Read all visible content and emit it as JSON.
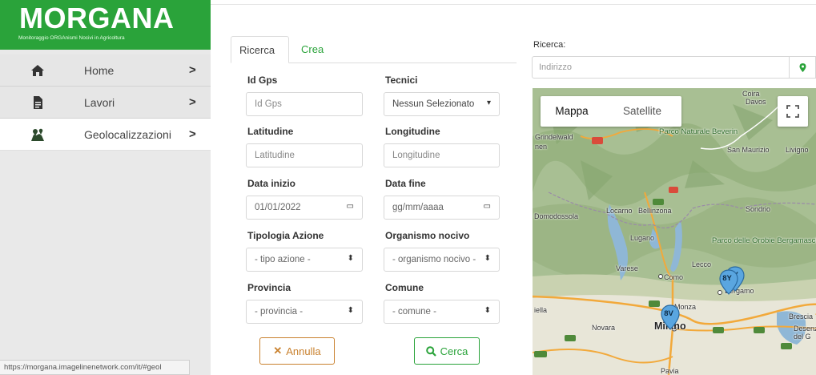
{
  "app": {
    "title": "MORGANA",
    "subtitle": "Monitoraggio ORGAnismi Nocivi in Agricoltura"
  },
  "sidebar": {
    "items": [
      {
        "label": "Home",
        "icon": "home-icon"
      },
      {
        "label": "Lavori",
        "icon": "document-icon"
      },
      {
        "label": "Geolocalizzazioni",
        "icon": "map-pins-icon",
        "active": true
      }
    ]
  },
  "status_url": "https://morgana.imagelinenetwork.com/it/#geol",
  "tabs": [
    {
      "label": "Ricerca",
      "active": true
    },
    {
      "label": "Crea",
      "active": false
    }
  ],
  "form": {
    "id_gps": {
      "label": "Id Gps",
      "placeholder": "Id Gps"
    },
    "tecnici": {
      "label": "Tecnici",
      "value": "Nessun Selezionato"
    },
    "latitudine": {
      "label": "Latitudine",
      "placeholder": "Latitudine"
    },
    "longitudine": {
      "label": "Longitudine",
      "placeholder": "Longitudine"
    },
    "data_inizio": {
      "label": "Data inizio",
      "value": "01/01/2022"
    },
    "data_fine": {
      "label": "Data fine",
      "value": "gg/mm/aaaa"
    },
    "tipologia_azione": {
      "label": "Tipologia Azione",
      "value": "- tipo azione -"
    },
    "organismo_nocivo": {
      "label": "Organismo nocivo",
      "value": "- organismo nocivo -"
    },
    "provincia": {
      "label": "Provincia",
      "value": "- provincia -"
    },
    "comune": {
      "label": "Comune",
      "value": "- comune -"
    }
  },
  "buttons": {
    "cancel": "Annulla",
    "search": "Cerca"
  },
  "map_search": {
    "label": "Ricerca:",
    "placeholder": "Indirizzo"
  },
  "map": {
    "type_map": "Mappa",
    "type_satellite": "Satellite",
    "places": {
      "coira": "Coira",
      "davos": "Davos",
      "grindelwald": "Grindelwald",
      "nen": "nen",
      "parco_nat": "Parco Naturale Beverin",
      "san_maurizio": "San Maurizio",
      "livigno": "Livigno",
      "domodossola": "Domodossola",
      "locarno": "Locarno",
      "bellinzona": "Bellinzona",
      "sondrio": "Sondrio",
      "lugano": "Lugano",
      "parco_orobie": "Parco delle Orobie Bergamasche",
      "varese": "Varese",
      "lecco": "Lecco",
      "como": "Como",
      "bergamo": "Bergamo",
      "monza": "Monza",
      "milano": "Milano",
      "novara": "Novara",
      "brescia": "Brescia",
      "desenzano": "Desenz del G",
      "pavia": "Pavia",
      "biella": "iella"
    },
    "markers": [
      {
        "label": "8Y"
      },
      {
        "label": "8V"
      }
    ],
    "colors": {
      "terrain": "#9fb98a",
      "water": "#8fb7d6",
      "highway": "#f2a93b",
      "marker": "#5aa6e0"
    }
  }
}
